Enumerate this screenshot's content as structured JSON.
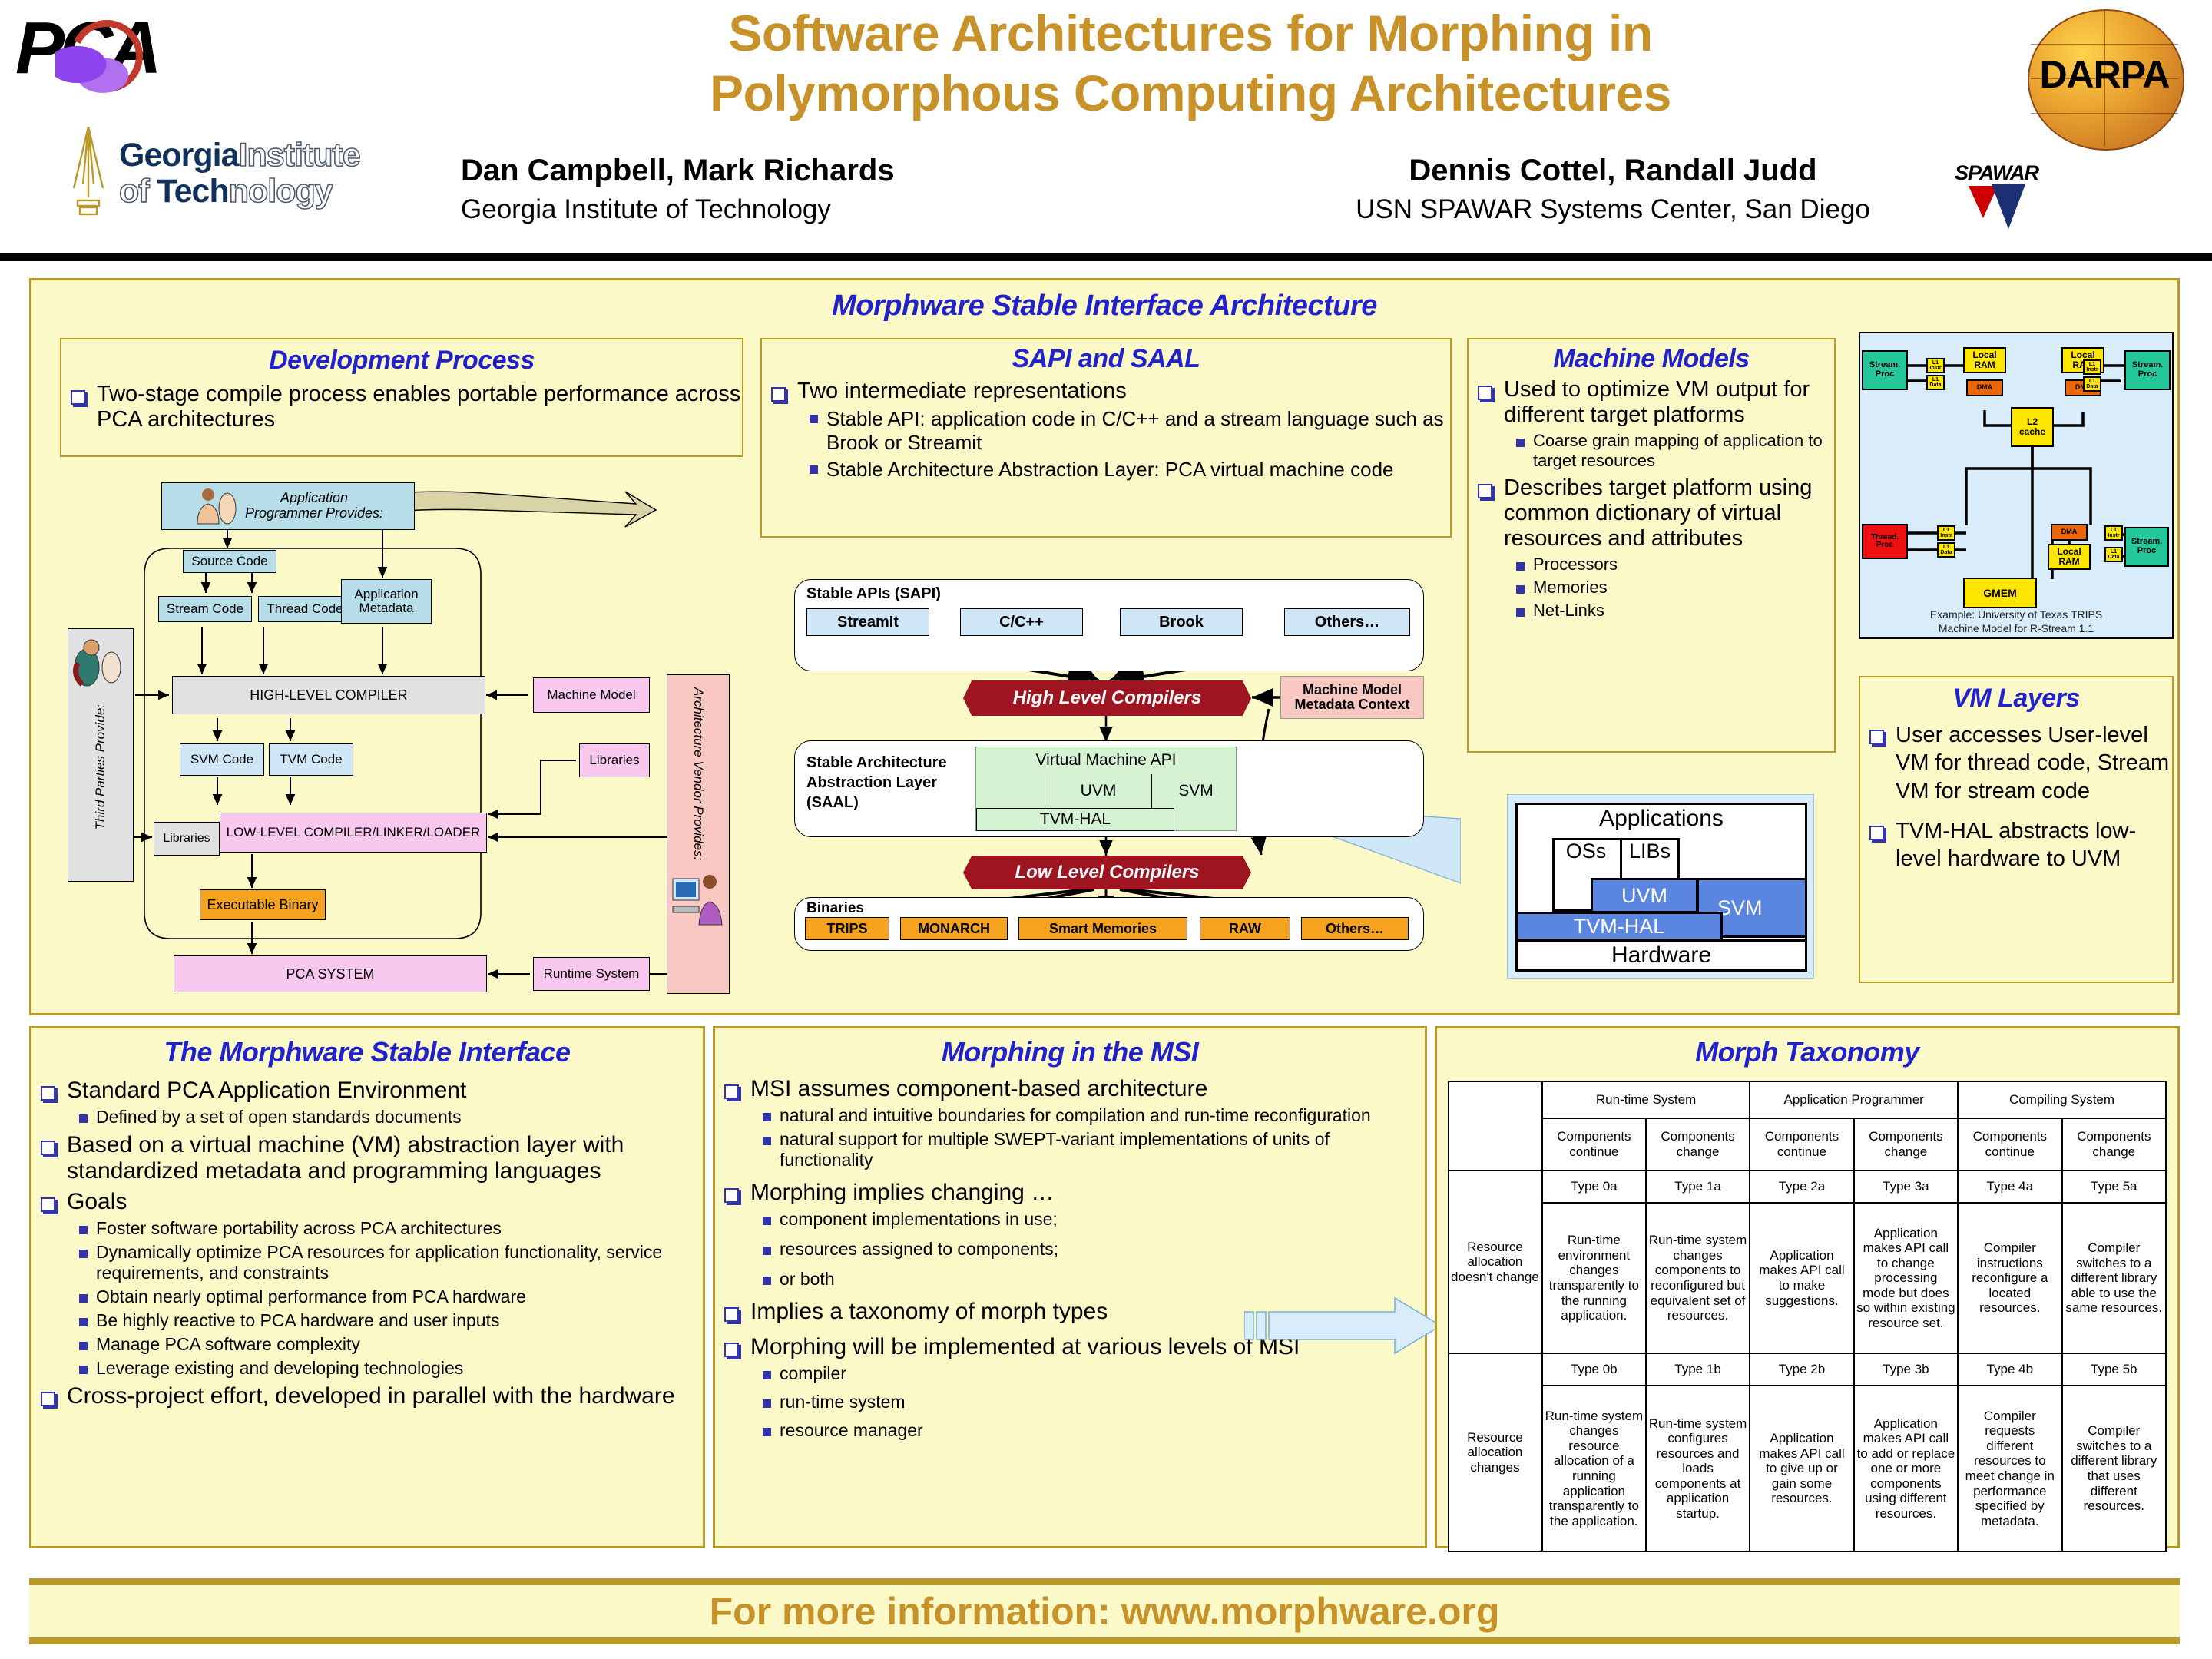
{
  "header": {
    "title_line1": "Software Architectures for Morphing in",
    "title_line2": "Polymorphous Computing Architectures",
    "pca_logo_text": "PCA",
    "gt_logo_line1_bold": "Georgia",
    "gt_logo_line1_thin": "Institute",
    "gt_logo_line2_thin_a": "of ",
    "gt_logo_line2_bold": "Tech",
    "gt_logo_line2_thin_b": "nology",
    "authors_left_names": "Dan Campbell, Mark Richards",
    "authors_left_affiliation": "Georgia Institute of Technology",
    "authors_right_names": "Dennis Cottel, Randall Judd",
    "authors_right_affiliation": "USN SPAWAR Systems Center, San Diego",
    "spawar_logo_text": "SPAWAR",
    "darpa_logo_text": "DARPA"
  },
  "architecture": {
    "title": "Morphware Stable Interface Architecture",
    "development_process": {
      "title": "Development Process",
      "bullets": [
        "Two-stage compile process enables portable performance across PCA architectures"
      ],
      "diagram": {
        "app_programmer_label_l1": "Application",
        "app_programmer_label_l2": "Programmer Provides:",
        "third_parties_label": "Third Parties Provide:",
        "arch_vendor_label": "Architecture Vendor Provides:",
        "source_code": "Source Code",
        "stream_code": "Stream Code",
        "thread_code": "Thread Code",
        "app_metadata_l1": "Application",
        "app_metadata_l2": "Metadata",
        "high_level_compiler": "HIGH-LEVEL COMPILER",
        "machine_model": "Machine Model",
        "svm_code": "SVM Code",
        "tvm_code": "TVM Code",
        "libraries_vendor": "Libraries",
        "libraries_third": "Libraries",
        "low_level_compiler": "LOW-LEVEL COMPILER/LINKER/LOADER",
        "executable_binary": "Executable Binary",
        "pca_system": "PCA SYSTEM",
        "runtime_system": "Runtime System"
      }
    },
    "sapi_saal": {
      "title": "SAPI and SAAL",
      "bullets": [
        {
          "text": "Two intermediate representations",
          "sub": [
            "Stable API: application code in C/C++ and a stream language such as Brook or Streamit",
            "Stable Architecture Abstraction Layer: PCA virtual machine code"
          ]
        }
      ],
      "diagram": {
        "sapi_group_label": "Stable APIs (SAPI)",
        "sapi_boxes": [
          "StreamIt",
          "C/C++",
          "Brook",
          "Others…"
        ],
        "high_level_compilers": "High Level Compilers",
        "machine_model_note_l1": "Machine Model",
        "machine_model_note_l2": "Metadata Context",
        "saal_group_label_l1": "Stable Architecture",
        "saal_group_label_l2": "Abstraction Layer",
        "saal_group_label_l3": "(SAAL)",
        "vm_api_label": "Virtual Machine API",
        "uvm": "UVM",
        "svm": "SVM",
        "tvm_hal": "TVM-HAL",
        "low_level_compilers": "Low Level Compilers",
        "binaries_group_label": "Binaries",
        "binary_boxes": [
          "TRIPS",
          "MONARCH",
          "Smart Memories",
          "RAW",
          "Others…"
        ]
      }
    },
    "machine_models": {
      "title": "Machine Models",
      "bullets": [
        {
          "text": "Used to optimize VM output for different target platforms",
          "sub": [
            "Coarse grain mapping of application to target resources"
          ]
        },
        {
          "text": "Describes target platform using common dictionary of virtual resources and attributes",
          "sub": [
            "Processors",
            "Memories",
            "Net-Links"
          ]
        }
      ]
    },
    "trips_diagram": {
      "caption_l1": "Example: University of Texas TRIPS",
      "caption_l2": "Machine Model for R-Stream 1.1",
      "nodes": {
        "stream_proc": "Stream. Proc",
        "thread_proc": "Thread. Proc",
        "local_ram_l1": "Local",
        "local_ram_l2": "RAM",
        "dma": "DMA",
        "l1_instr_l1": "L1",
        "l1_instr_l2": "Instr",
        "l1_data_l1": "L1",
        "l1_data_l2": "Data",
        "l2_cache_l1": "L2",
        "l2_cache_l2": "cache",
        "gmem": "GMEM"
      }
    },
    "vm_layers": {
      "title": "VM Layers",
      "bullets": [
        "User accesses User-level VM for thread code, Stream VM for stream code",
        "TVM-HAL abstracts low-level hardware to UVM"
      ],
      "stack": {
        "applications": "Applications",
        "oss": "OSs",
        "libs": "LIBs",
        "uvm": "UVM",
        "svm": "SVM",
        "tvm_hal": "TVM-HAL",
        "hardware": "Hardware"
      }
    }
  },
  "msi_panel": {
    "title": "The Morphware Stable Interface",
    "bullets": [
      {
        "text": "Standard PCA Application Environment",
        "sub": [
          "Defined by a set of open standards documents"
        ]
      },
      {
        "text": "Based on a virtual machine (VM) abstraction layer with standardized metadata and programming languages",
        "sub": []
      },
      {
        "text": "Goals",
        "sub": [
          "Foster software portability across PCA architectures",
          "Dynamically optimize PCA resources for application functionality, service requirements, and constraints",
          "Obtain nearly optimal performance from PCA hardware",
          "Be highly reactive to PCA hardware and user inputs",
          "Manage PCA software complexity",
          "Leverage existing and developing technologies"
        ]
      },
      {
        "text": "Cross-project effort, developed in parallel with the hardware",
        "sub": []
      }
    ]
  },
  "morphing_panel": {
    "title": "Morphing in the MSI",
    "bullets": [
      {
        "text": "MSI assumes component-based architecture",
        "sub": [
          "natural and intuitive boundaries for compilation and run-time reconfiguration",
          "natural support for multiple SWEPT-variant implementations of units of functionality"
        ]
      },
      {
        "text": "Morphing implies changing …",
        "sub": [
          "component implementations in use;",
          "resources assigned to components;",
          "or both"
        ]
      },
      {
        "text": "Implies a taxonomy of morph types",
        "sub": []
      },
      {
        "text": "Morphing will be implemented at various levels of MSI",
        "sub": [
          "compiler",
          "run-time system",
          "resource manager"
        ]
      }
    ]
  },
  "taxonomy": {
    "title": "Morph Taxonomy",
    "group_headers": [
      "Run-time System",
      "Application Programmer",
      "Compiling System"
    ],
    "sub_headers": [
      "Components continue",
      "Components change",
      "Components continue",
      "Components change",
      "Components continue",
      "Components change"
    ],
    "row_labels": [
      "Resource allocation doesn't change",
      "Resource allocation changes"
    ],
    "type_row_a": [
      "Type 0a",
      "Type 1a",
      "Type 2a",
      "Type 3a",
      "Type 4a",
      "Type 5a"
    ],
    "desc_row_a": [
      "Run-time environment changes transparently to the running application.",
      "Run-time system changes components to reconfigured but equivalent set of resources.",
      "Application makes API call to make suggestions.",
      "Application makes API call to change processing mode but does so within existing resource set.",
      "Compiler instructions reconfigure a located resources.",
      "Compiler switches to a different library able to use the same resources."
    ],
    "type_row_b": [
      "Type 0b",
      "Type 1b",
      "Type 2b",
      "Type 3b",
      "Type 4b",
      "Type 5b"
    ],
    "desc_row_b": [
      "Run-time system changes resource allocation of a running application transparently to the application.",
      "Run-time system configures resources and loads components at application startup.",
      "Application makes API call to give up or gain some resources.",
      "Application makes API call to add or replace one or more components using different resources.",
      "Compiler requests different resources to meet change in performance specified by metadata.",
      "Compiler switches to a different library that uses different resources."
    ]
  },
  "footer": {
    "text": "For more information: www.morphware.org"
  }
}
